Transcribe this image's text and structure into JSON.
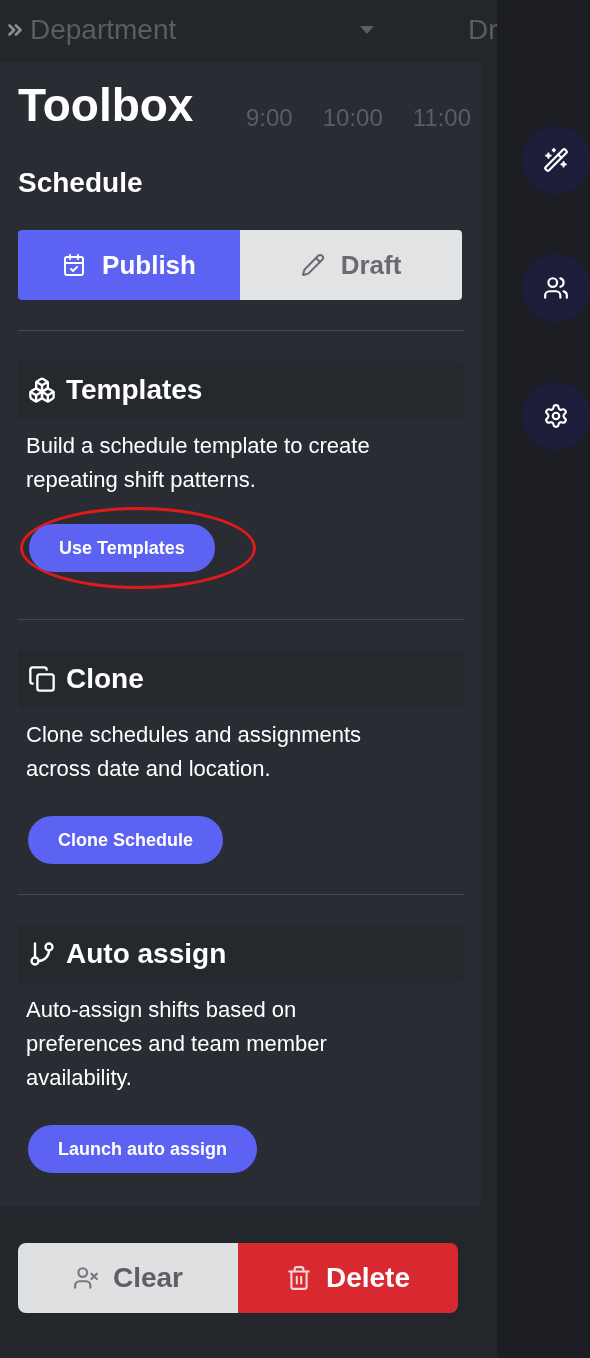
{
  "background": {
    "department_select": "Department",
    "drawing_label": "Dr",
    "times": [
      "9:00",
      "10:00",
      "11:00"
    ]
  },
  "toolbox": {
    "title": "Toolbox",
    "schedule_heading": "Schedule",
    "mode_buttons": [
      {
        "kind": "publish",
        "label": "Publish",
        "selected": true
      },
      {
        "kind": "draft",
        "label": "Draft",
        "selected": false
      }
    ],
    "sections": [
      {
        "kind": "templates",
        "title": "Templates",
        "description": "Build a schedule template to create repeating shift patterns.",
        "button": "Use Templates",
        "highlighted": true
      },
      {
        "kind": "clone",
        "title": "Clone",
        "description": "Clone schedules and assignments across date and location.",
        "button": "Clone Schedule",
        "highlighted": false
      },
      {
        "kind": "auto",
        "title": "Auto assign",
        "description": "Auto-assign shifts based on preferences and team member availability.",
        "button": "Launch auto assign",
        "highlighted": false
      }
    ]
  },
  "actions": [
    {
      "kind": "clear",
      "label": "Clear"
    },
    {
      "kind": "delete",
      "label": "Delete"
    }
  ],
  "side_buttons": [
    {
      "kind": "wand"
    },
    {
      "kind": "team"
    },
    {
      "kind": "gears"
    }
  ]
}
